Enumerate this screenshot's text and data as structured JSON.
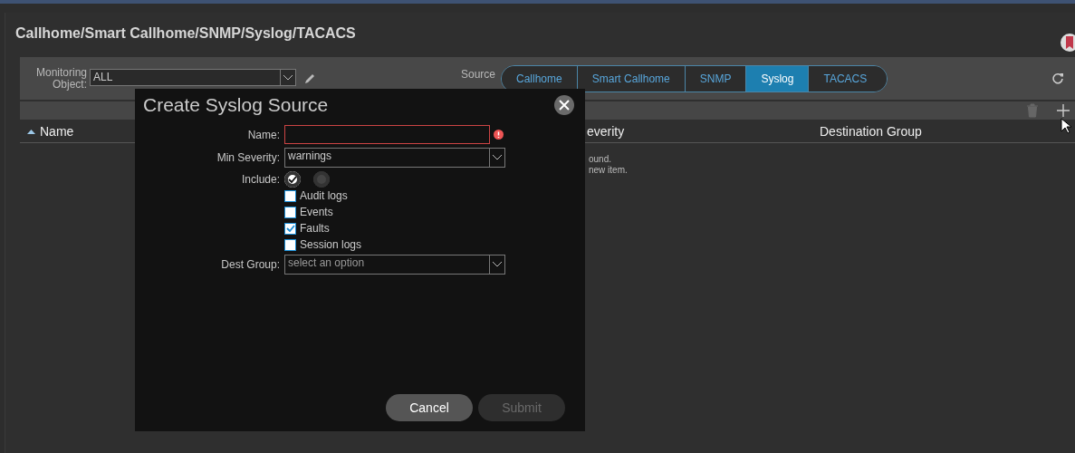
{
  "page": {
    "title": "Callhome/Smart Callhome/SNMP/Syslog/TACACS"
  },
  "filters": {
    "monitoring_label": "Monitoring Object:",
    "monitoring_value": "ALL",
    "source_type_label": "Source"
  },
  "source_tabs": [
    {
      "label": "Callhome",
      "selected": false
    },
    {
      "label": "Smart Callhome",
      "selected": false
    },
    {
      "label": "SNMP",
      "selected": false
    },
    {
      "label": "Syslog",
      "selected": true
    },
    {
      "label": "TACACS",
      "selected": false
    }
  ],
  "table": {
    "columns": [
      "Name",
      "everity",
      "Destination Group"
    ],
    "empty_lines": [
      "ound.",
      "new item."
    ]
  },
  "dialog": {
    "title": "Create Syslog Source",
    "name_label": "Name:",
    "name_invalid": true,
    "severity_label": "Min Severity:",
    "severity_value": "warnings",
    "include_label": "Include:",
    "include_toggles": [
      {
        "checked": true
      },
      {
        "checked": false
      }
    ],
    "include_options": [
      {
        "label": "Audit logs",
        "checked": false
      },
      {
        "label": "Events",
        "checked": false
      },
      {
        "label": "Faults",
        "checked": true
      },
      {
        "label": "Session logs",
        "checked": false
      }
    ],
    "dest_label": "Dest Group:",
    "dest_placeholder": "select an option",
    "buttons": [
      {
        "label": "Cancel",
        "disabled": false
      },
      {
        "label": "Submit",
        "disabled": true
      }
    ]
  }
}
